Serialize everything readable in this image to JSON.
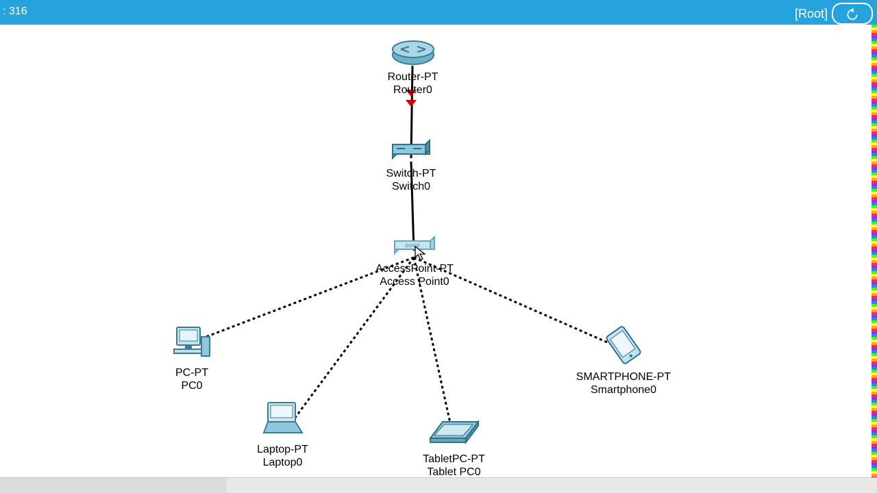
{
  "header": {
    "left_text": ": 316",
    "root_label": "[Root]"
  },
  "devices": {
    "router": {
      "type": "Router-PT",
      "name": "Router0"
    },
    "switch": {
      "type": "Switch-PT",
      "name": "Switch0"
    },
    "ap": {
      "type": "AccessPoint-PT",
      "name": "Access Point0"
    },
    "pc": {
      "type": "PC-PT",
      "name": "PC0"
    },
    "laptop": {
      "type": "Laptop-PT",
      "name": "Laptop0"
    },
    "tablet": {
      "type": "TabletPC-PT",
      "name": "Tablet PC0"
    },
    "smartphone": {
      "type": "SMARTPHONE-PT",
      "name": "Smartphone0"
    }
  }
}
